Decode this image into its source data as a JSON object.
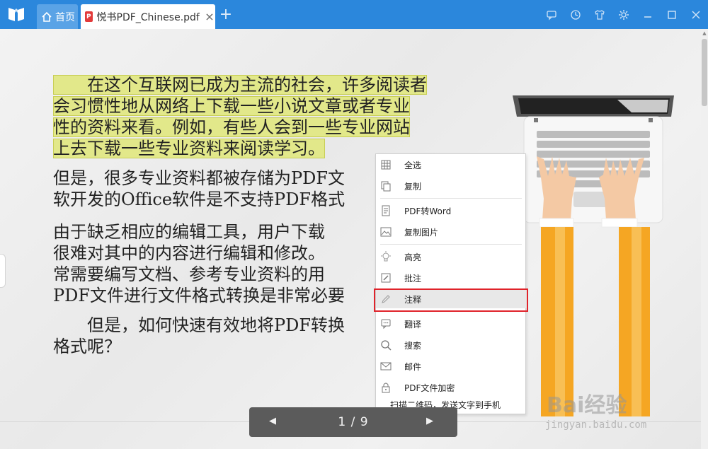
{
  "tabs": {
    "home_label": "首页",
    "doc_title": "悦书PDF_Chinese.pdf",
    "close_glyph": "×",
    "add_glyph": "+",
    "pdf_badge": "P"
  },
  "window_controls": [
    "feedback-icon",
    "history-icon",
    "skin-icon",
    "settings-icon",
    "minimize-icon",
    "maximize-icon",
    "close-icon"
  ],
  "document": {
    "para1_lines": [
      "　　在这个互联网已成为主流的社会，许多阅读者",
      "会习惯性地从网络上下载一些小说文章或者专业",
      "性的资料来看。例如，有些人会到一些专业网站",
      "上去下载一些专业资料来阅读学习。"
    ],
    "para2_lines": [
      "但是，很多专业资料都被存储为PDF文",
      "软开发的Office软件是不支持PDF格式"
    ],
    "para3_lines": [
      "由于缺乏相应的编辑工具，用户下载",
      "很难对其中的内容进行编辑和修改。",
      "常需要编写文档、参考专业资料的用",
      "PDF文件进行文件格式转换是非常必要"
    ],
    "para4_lines": [
      "　　但是，如何快速有效地将PDF转换",
      "格式呢？"
    ]
  },
  "context_menu": {
    "items": [
      {
        "label": "全选",
        "icon": "select-all-icon"
      },
      {
        "label": "复制",
        "icon": "copy-icon"
      },
      {
        "label": "PDF转Word",
        "icon": "pdf-to-word-icon"
      },
      {
        "label": "复制图片",
        "icon": "copy-image-icon"
      },
      {
        "label": "高亮",
        "icon": "highlight-icon"
      },
      {
        "label": "批注",
        "icon": "comment-icon"
      },
      {
        "label": "注释",
        "icon": "annotate-pencil-icon"
      },
      {
        "label": "翻译",
        "icon": "translate-icon"
      },
      {
        "label": "搜索",
        "icon": "search-icon"
      },
      {
        "label": "邮件",
        "icon": "mail-icon"
      },
      {
        "label": "PDF文件加密",
        "icon": "lock-icon"
      }
    ],
    "qr_note": "扫描二维码，发送文字到手机",
    "highlighted_item": "注释"
  },
  "page_nav": {
    "indicator": "1 / 9",
    "prev_glyph": "◀",
    "next_glyph": "▶"
  },
  "watermark": {
    "brand": "Bai经验",
    "url": "jingyan.baidu.com"
  },
  "colors": {
    "titlebar": "#2b87dc",
    "text_highlight": "#e2e88a",
    "red_box": "#e0232a",
    "nav_bg": "#5b5b5b"
  }
}
